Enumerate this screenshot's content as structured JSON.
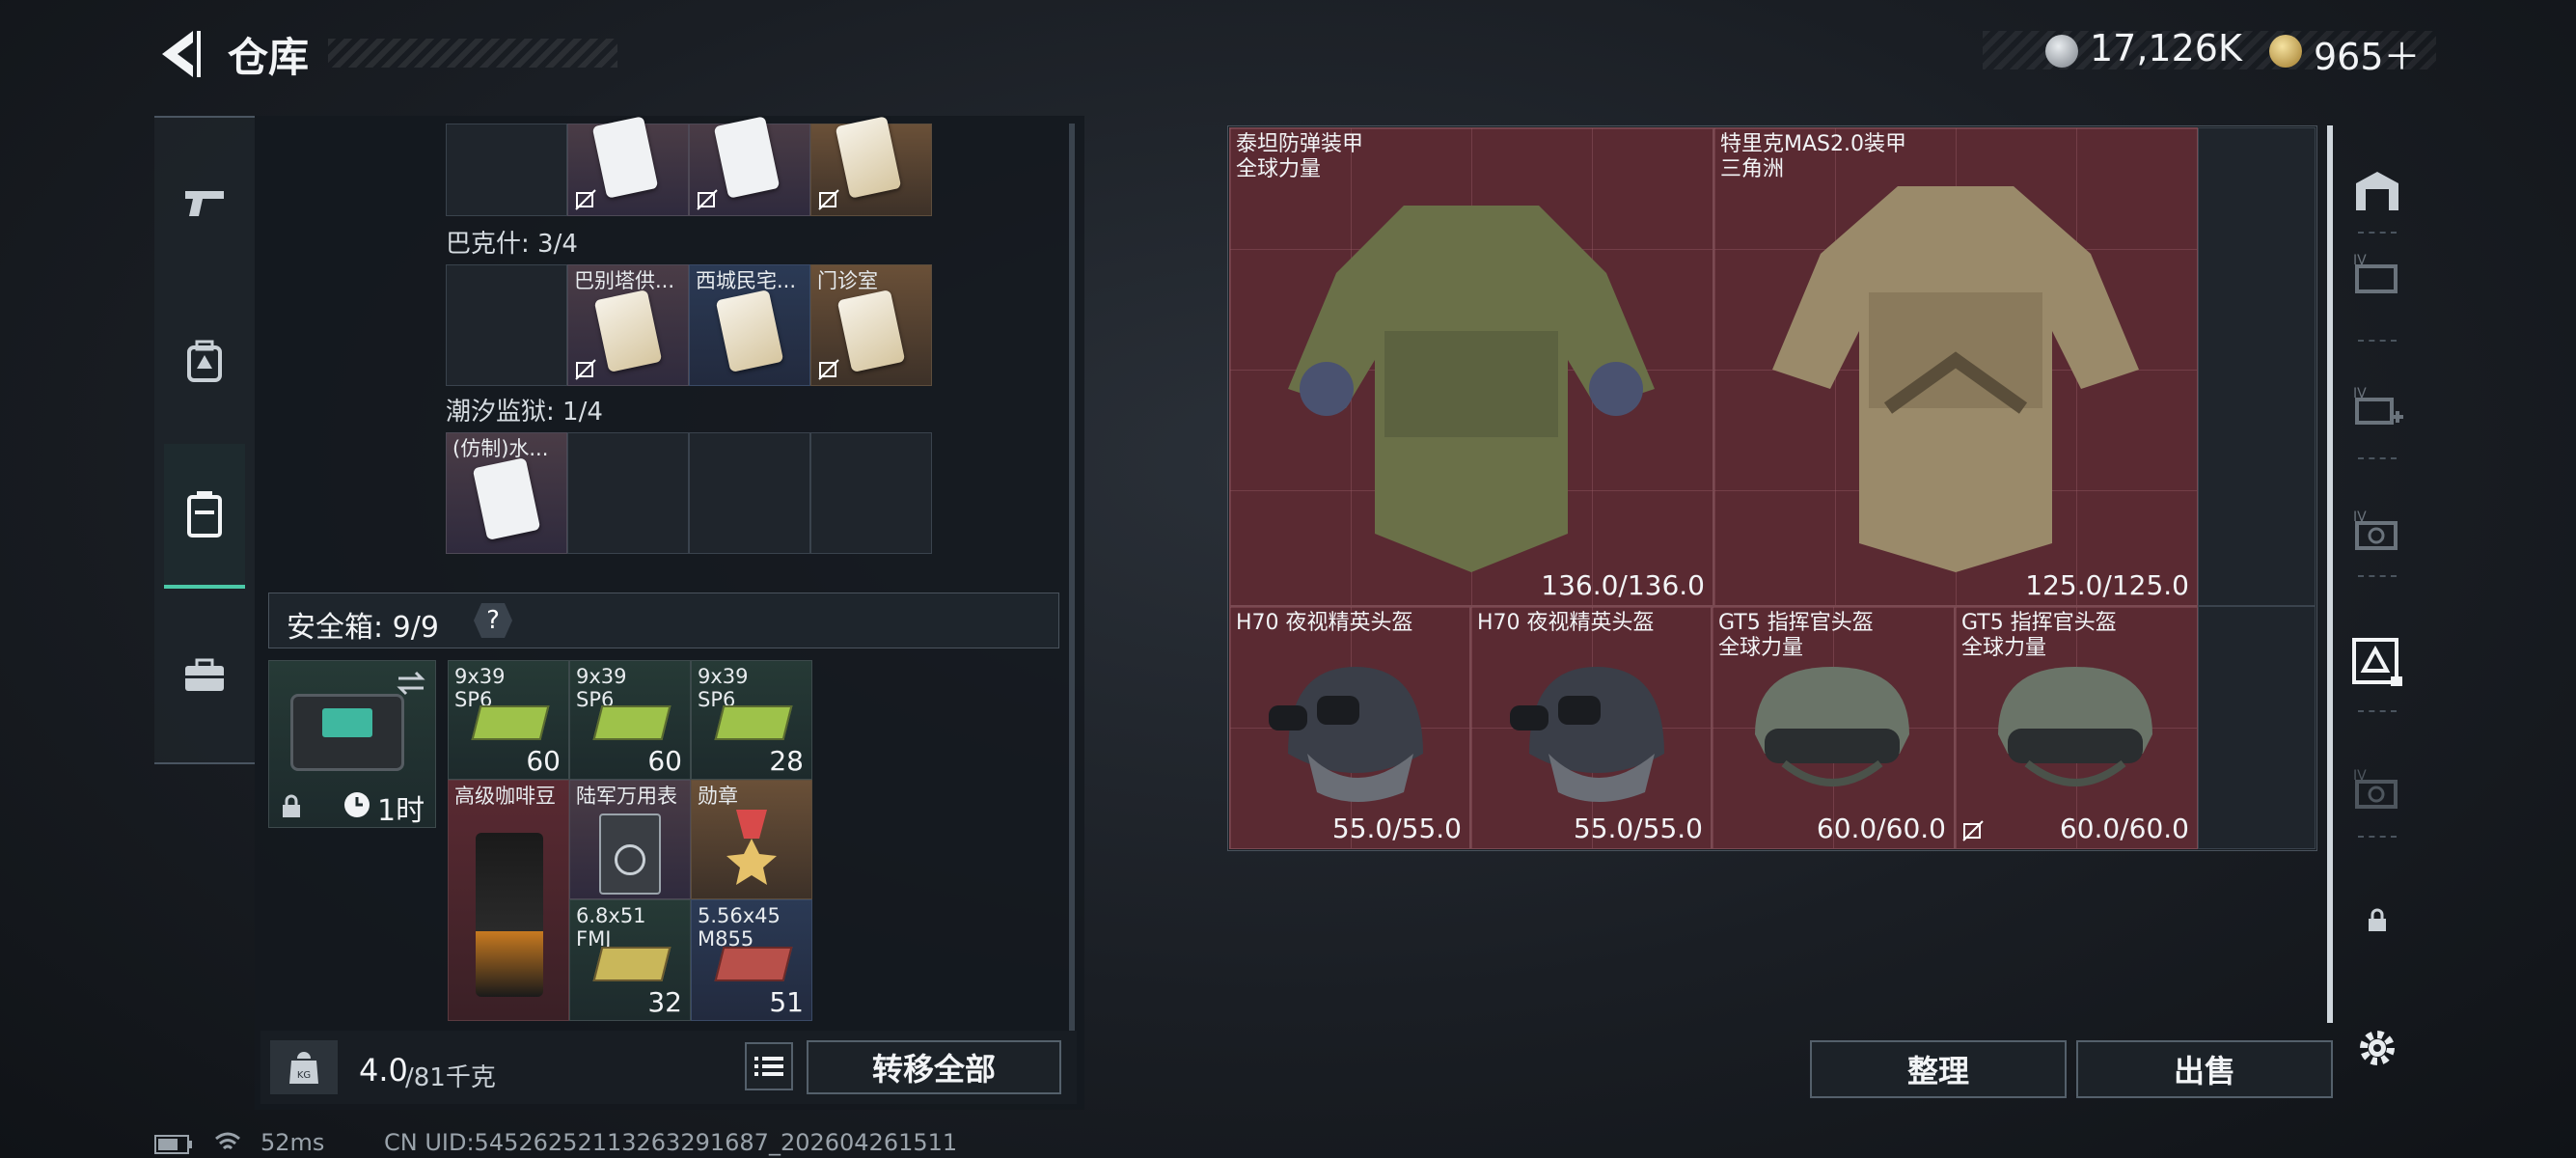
{
  "header": {
    "title": "仓库",
    "currency1": "17,126K",
    "currency2": "965＋"
  },
  "left_nav": [
    {
      "name": "weapons",
      "icon": "pistol-icon"
    },
    {
      "name": "equipment",
      "icon": "backpack-icon"
    },
    {
      "name": "storage",
      "icon": "locker-icon",
      "active": true
    },
    {
      "name": "toolbox",
      "icon": "briefcase-icon"
    }
  ],
  "keycards": {
    "bakesh_label": "巴克什: 3/4",
    "bakesh_items": [
      "巴别塔供...",
      "西城民宅...",
      "门诊室"
    ],
    "tide_label": "潮汐监狱: 1/4",
    "tide_items": [
      "(仿制)水..."
    ]
  },
  "safebox": {
    "label": "安全箱: 9/9",
    "help": "?",
    "timer": "1时",
    "items": [
      {
        "name": "9x39\nSP6",
        "count": "60"
      },
      {
        "name": "9x39\nSP6",
        "count": "60"
      },
      {
        "name": "9x39\nSP6",
        "count": "28"
      },
      {
        "name": "高级咖啡豆",
        "count": ""
      },
      {
        "name": "陆军万用表",
        "count": ""
      },
      {
        "name": "勋章",
        "count": ""
      },
      {
        "name": "6.8x51\nFMJ",
        "count": "32"
      },
      {
        "name": "5.56x45\nM855",
        "count": "51"
      }
    ]
  },
  "weight": {
    "current": "4.0",
    "max": "/81千克",
    "transfer_all": "转移全部"
  },
  "storage": {
    "armor": [
      {
        "name": "泰坦防弹装甲",
        "sub": "全球力量",
        "durability": "136.0/136.0"
      },
      {
        "name": "特里克MAS2.0装甲",
        "sub": "三角洲",
        "durability": "125.0/125.0"
      }
    ],
    "helmets": [
      {
        "name": "H70 夜视精英头盔",
        "sub": "",
        "durability": "55.0/55.0"
      },
      {
        "name": "H70 夜视精英头盔",
        "sub": "",
        "durability": "55.0/55.0"
      },
      {
        "name": "GT5 指挥官头盔",
        "sub": "全球力量",
        "durability": "60.0/60.0"
      },
      {
        "name": "GT5 指挥官头盔",
        "sub": "全球力量",
        "durability": "60.0/60.0"
      }
    ],
    "sort_label": "整理",
    "sell_label": "出售"
  },
  "status_bar": {
    "ping": "52ms",
    "uid": "CN UID:54526252113263291687_202604261511"
  },
  "colors": {
    "accent": "#4bc9a8",
    "armor_bg": "#5a2a32",
    "panel": "#14191f"
  }
}
